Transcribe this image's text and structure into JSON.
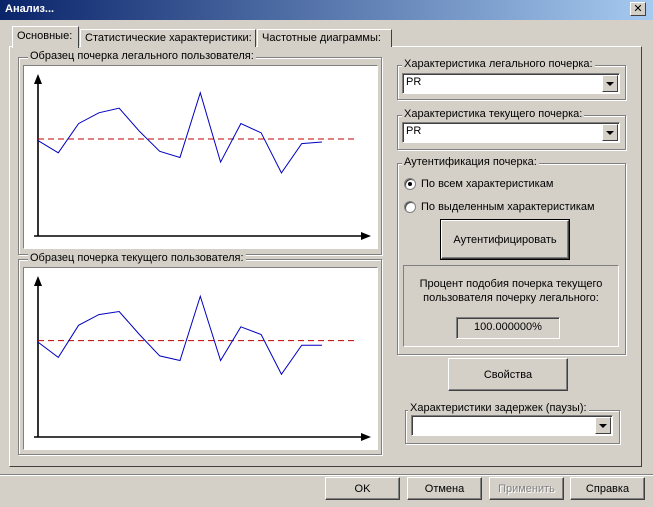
{
  "window": {
    "title": "Анализ..."
  },
  "tabs": [
    {
      "label": "Основные:",
      "active": true
    },
    {
      "label": "Статистические характеристики:",
      "active": false
    },
    {
      "label": "Частотные диаграммы:",
      "active": false
    }
  ],
  "plots": {
    "legal_title": "Образец почерка легального пользователя:",
    "current_title": "Образец почерка текущего пользователя:",
    "colors": {
      "series": "#0000c0",
      "threshold": "#c00000",
      "axes": "#000000"
    },
    "chart_data": [
      {
        "type": "line",
        "title": "Образец почерка легального пользователя:",
        "series": [
          {
            "values": [
              0.62,
              0.54,
              0.73,
              0.8,
              0.83,
              0.68,
              0.55,
              0.51,
              0.93,
              0.48,
              0.73,
              0.67,
              0.41,
              0.6,
              0.61
            ]
          }
        ],
        "threshold": 0.63,
        "grid": false
      },
      {
        "type": "line",
        "title": "Образец почерка текущего пользователя:",
        "series": [
          {
            "values": [
              0.62,
              0.52,
              0.73,
              0.8,
              0.82,
              0.67,
              0.53,
              0.5,
              0.92,
              0.5,
              0.72,
              0.67,
              0.41,
              0.6,
              0.6
            ]
          }
        ],
        "threshold": 0.63,
        "grid": false
      }
    ]
  },
  "legal_characteristic": {
    "title": "Характеристика легального почерка:",
    "value": "PR"
  },
  "current_characteristic": {
    "title": "Характеристика текущего почерка:",
    "value": "PR"
  },
  "auth": {
    "title": "Аутентификация почерка:",
    "radio_all": "По всем характеристикам",
    "radio_selected": "По выделенным характеристикам",
    "authenticate_button": "Аутентифицировать",
    "similarity_label_1": "Процент подобия почерка текущего",
    "similarity_label_2": "пользователя почерку легального:",
    "similarity_value": "100.000000%"
  },
  "properties_button": "Свойства",
  "delays": {
    "title": "Характеристики задержек (паузы):",
    "value": ""
  },
  "footer": {
    "ok": "OK",
    "cancel": "Отмена",
    "apply": "Применить",
    "help": "Справка"
  }
}
